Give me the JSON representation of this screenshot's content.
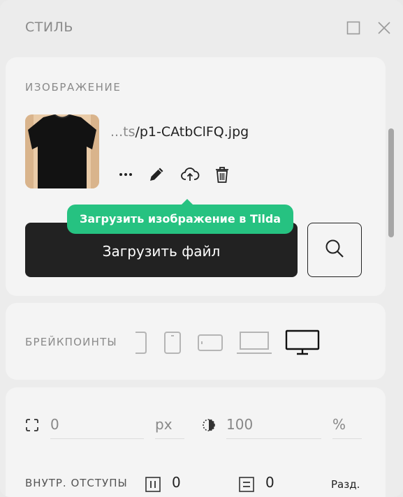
{
  "header": {
    "title": "СТИЛЬ",
    "maximize_icon": "maximize-icon",
    "close_icon": "close-icon"
  },
  "image_section": {
    "title": "ИЗОБРАЖЕНИЕ",
    "file_prefix": "...ts",
    "file_name": "/p1-CAtbClFQ.jpg",
    "actions": [
      "more-icon",
      "pencil-icon",
      "cloud-upload-icon",
      "trash-icon"
    ],
    "tooltip": "Загрузить изображение в Tilda",
    "upload_button": "Загрузить файл",
    "search_icon": "search-icon"
  },
  "breakpoints": {
    "label": "БРЕЙКПОИНТЫ",
    "devices": [
      "phone-icon",
      "tablet-portrait-icon",
      "tablet-landscape-icon",
      "laptop-icon",
      "desktop-icon"
    ],
    "active": "desktop-icon"
  },
  "properties": {
    "border_radius": {
      "value": "0",
      "unit": "px"
    },
    "opacity": {
      "value": "100",
      "unit": "%"
    },
    "padding": {
      "label": "ВНУТР. ОТСТУПЫ",
      "horizontal": "0",
      "vertical": "0",
      "separate_label": "Разд."
    }
  },
  "colors": {
    "accent": "#26c281",
    "button_dark": "#222222",
    "panel": "#ececec",
    "card": "#f4f4f4"
  }
}
